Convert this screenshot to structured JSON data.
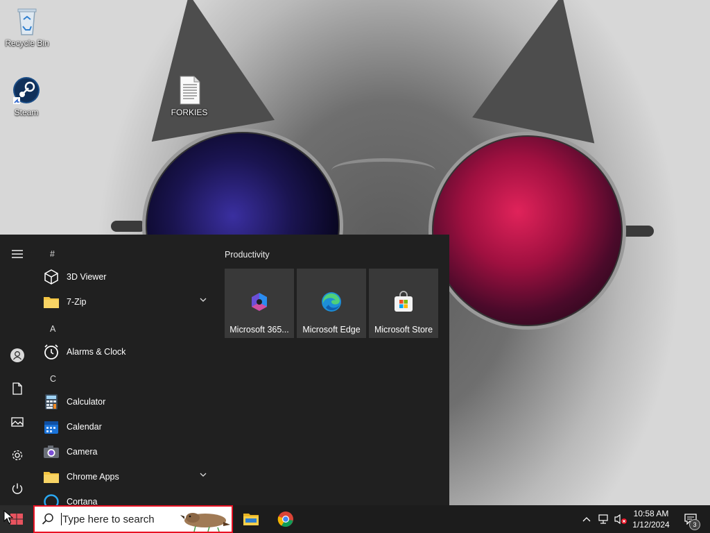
{
  "desktop": {
    "icons": [
      {
        "label": "Recycle Bin"
      },
      {
        "label": "Steam"
      },
      {
        "label": "FORKIES"
      }
    ]
  },
  "start_menu": {
    "app_list": {
      "letters": [
        "#",
        "A",
        "C"
      ],
      "apps": [
        {
          "label": "3D Viewer",
          "icon": "cube-icon",
          "expandable": false
        },
        {
          "label": "7-Zip",
          "icon": "folder-icon",
          "expandable": true
        },
        {
          "label": "Alarms & Clock",
          "icon": "alarm-clock-icon",
          "expandable": false
        },
        {
          "label": "Calculator",
          "icon": "calculator-icon",
          "expandable": false
        },
        {
          "label": "Calendar",
          "icon": "calendar-icon",
          "expandable": false
        },
        {
          "label": "Camera",
          "icon": "camera-icon",
          "expandable": false
        },
        {
          "label": "Chrome Apps",
          "icon": "folder-icon",
          "expandable": true
        },
        {
          "label": "Cortana",
          "icon": "cortana-icon",
          "expandable": false
        }
      ]
    },
    "tiles": {
      "group_title": "Productivity",
      "items": [
        {
          "label": "Microsoft 365..."
        },
        {
          "label": "Microsoft Edge"
        },
        {
          "label": "Microsoft Store"
        }
      ]
    }
  },
  "taskbar": {
    "search_placeholder": "Type here to search",
    "clock": {
      "time": "10:58 AM",
      "date": "1/12/2024"
    },
    "notification_count": "3"
  },
  "colors": {
    "start_bg": "#202020",
    "tile_bg": "#393939",
    "taskbar_bg": "#1c1c1c",
    "search_border": "#e81123"
  }
}
